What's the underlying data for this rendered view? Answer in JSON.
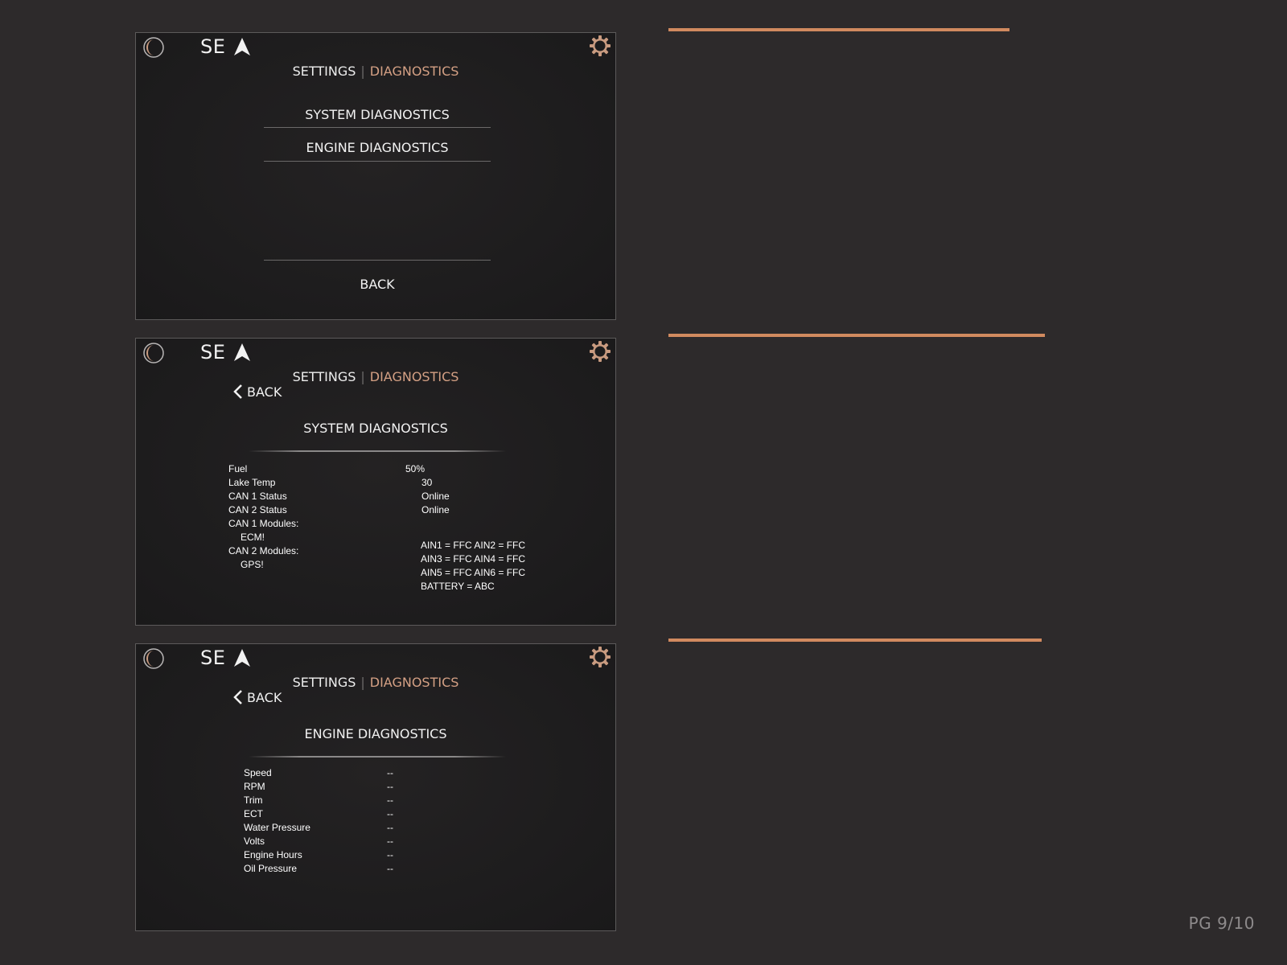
{
  "brand": {
    "text": "SE"
  },
  "breadcrumb": {
    "parent": "SETTINGS",
    "separator": "|",
    "current": "DIAGNOSTICS"
  },
  "colors": {
    "accent": "#d18a5f",
    "breadcrumb_active": "#d4a084",
    "background": "#2d2a2b"
  },
  "icons": {
    "night_mode": "moon-icon",
    "navigation": "navigation-arrow-icon",
    "settings": "gear-icon",
    "back": "chevron-left-icon"
  },
  "screen1": {
    "menu": [
      "SYSTEM DIAGNOSTICS",
      "ENGINE DIAGNOSTICS"
    ],
    "back_label": "BACK"
  },
  "screen2": {
    "back_label": "BACK",
    "title": "SYSTEM DIAGNOSTICS",
    "labels": [
      "Fuel",
      "Lake Temp",
      "CAN 1 Status",
      "CAN 2 Status",
      "CAN 1 Modules:",
      "ECM!",
      "CAN 2 Modules:",
      "GPS!"
    ],
    "fuel_value": "50%",
    "values": [
      "30",
      "Online",
      "Online"
    ],
    "ain_values": [
      "AIN1 = FFC AIN2 = FFC",
      "AIN3 = FFC AIN4 = FFC",
      "AIN5 = FFC AIN6 = FFC",
      "BATTERY = ABC"
    ]
  },
  "screen3": {
    "back_label": "BACK",
    "title": "ENGINE DIAGNOSTICS",
    "labels": [
      "Speed",
      "RPM",
      "Trim",
      "ECT",
      "Water Pressure",
      "Volts",
      "Engine Hours",
      "Oil Pressure"
    ],
    "values": [
      "--",
      "--",
      "--",
      "--",
      "--",
      "--",
      "--",
      "--"
    ]
  },
  "page_number": "PG 9/10"
}
